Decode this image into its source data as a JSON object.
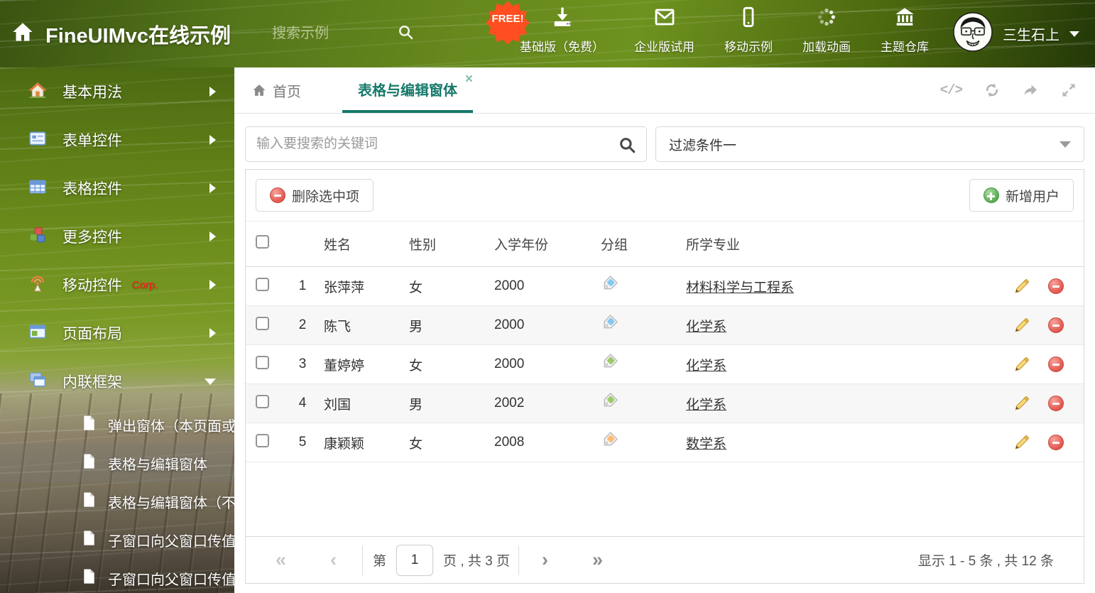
{
  "colors": {
    "accent_teal": "#17796B",
    "delete_red": "#E2544B",
    "add_green": "#57AB51",
    "corp_red": "#FF1A1A",
    "free_badge_orange": "#FF4E1F",
    "tag_blue": "#85C9F2",
    "tag_green": "#9CCB67",
    "tag_orange": "#FFBB73"
  },
  "header": {
    "title": "FineUIMvc在线示例",
    "search_placeholder": "搜索示例",
    "free_badge": "FREE!",
    "nav": [
      {
        "label": "基础版（免费）",
        "icon": "download-icon"
      },
      {
        "label": "企业版试用",
        "icon": "envelope-icon"
      },
      {
        "label": "移动示例",
        "icon": "mobile-icon"
      },
      {
        "label": "加载动画",
        "icon": "spinner-icon"
      },
      {
        "label": "主题仓库",
        "icon": "bank-icon"
      }
    ],
    "user_name": "三生石上"
  },
  "sidebar": {
    "items": [
      {
        "label": "基本用法",
        "icon": "home-icon"
      },
      {
        "label": "表单控件",
        "icon": "form-icon"
      },
      {
        "label": "表格控件",
        "icon": "table-icon"
      },
      {
        "label": "更多控件",
        "icon": "cubes-icon"
      },
      {
        "label": "移动控件",
        "badge": "Corp.",
        "icon": "antenna-icon"
      },
      {
        "label": "页面布局",
        "icon": "layout-icon"
      },
      {
        "label": "内联框架",
        "icon": "frames-icon",
        "expanded": true
      }
    ],
    "subitems": [
      {
        "label": "弹出窗体（本页面或..."
      },
      {
        "label": "表格与编辑窗体",
        "selected": true
      },
      {
        "label": "表格与编辑窗体（不..."
      },
      {
        "label": "子窗口向父窗口传值"
      },
      {
        "label": "子窗口向父窗口传值..."
      }
    ]
  },
  "tabs": {
    "home_label": "首页",
    "active_label": "表格与编辑窗体"
  },
  "filter_bar": {
    "search_placeholder": "输入要搜索的关键词",
    "filter_value": "过滤条件一"
  },
  "grid": {
    "toolbar": {
      "delete_label": "删除选中项",
      "add_label": "新增用户"
    },
    "columns": {
      "name": "姓名",
      "gender": "性别",
      "year": "入学年份",
      "group": "分组",
      "major": "所学专业"
    },
    "rows": [
      {
        "index": "1",
        "name": "张萍萍",
        "gender": "女",
        "year": "2000",
        "tag_color": "#85C9F2",
        "major": "材料科学与工程系"
      },
      {
        "index": "2",
        "name": "陈飞",
        "gender": "男",
        "year": "2000",
        "tag_color": "#85C9F2",
        "major": "化学系"
      },
      {
        "index": "3",
        "name": "董婷婷",
        "gender": "女",
        "year": "2000",
        "tag_color": "#9CCB67",
        "major": "化学系"
      },
      {
        "index": "4",
        "name": "刘国",
        "gender": "男",
        "year": "2002",
        "tag_color": "#9CCB67",
        "major": "化学系"
      },
      {
        "index": "5",
        "name": "康颖颖",
        "gender": "女",
        "year": "2008",
        "tag_color": "#FFBB73",
        "major": "数学系"
      }
    ]
  },
  "pagination": {
    "prefix": "第",
    "page": "1",
    "suffix": "页 , 共 3 页",
    "summary": "显示 1 - 5 条 , 共 12 条"
  }
}
